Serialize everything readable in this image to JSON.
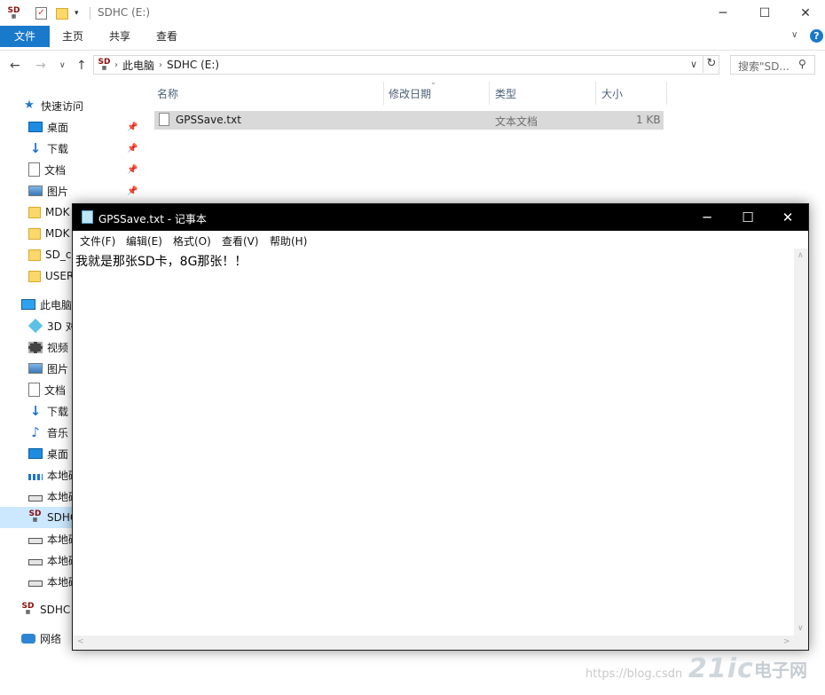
{
  "explorer": {
    "window_title": "SDHC (E:)",
    "ribbon_tabs": [
      "文件",
      "主页",
      "共享",
      "查看"
    ],
    "breadcrumb": [
      "此电脑",
      "SDHC (E:)"
    ],
    "search_placeholder": "搜索\"SD...",
    "columns": [
      "名称",
      "修改日期",
      "类型",
      "大小"
    ],
    "files": [
      {
        "name": "GPSSave.txt",
        "type": "文本文档",
        "size": "1 KB"
      }
    ],
    "nav": {
      "quick_access": "快速访问",
      "quick_items": [
        "桌面",
        "下载",
        "文档",
        "图片",
        "MDK",
        "MDK",
        "SD_c",
        "USER"
      ],
      "this_pc": "此电脑",
      "pc_items": [
        "3D 对",
        "视频",
        "图片",
        "文档",
        "下载",
        "音乐",
        "桌面",
        "本地磁",
        "本地磁",
        "SDHC",
        "本地磁",
        "本地磁",
        "本地磁"
      ],
      "sdhc": "SDHC",
      "network": "网络"
    },
    "sd_logo_text": "SD"
  },
  "notepad": {
    "title": "GPSSave.txt - 记事本",
    "menu": [
      "文件(F)",
      "编辑(E)",
      "格式(O)",
      "查看(V)",
      "帮助(H)"
    ],
    "content": "我就是那张SD卡，8G那张！！"
  },
  "watermark": {
    "url": "https://blog.csdn",
    "logo": "21ic",
    "cn": "电子网"
  }
}
